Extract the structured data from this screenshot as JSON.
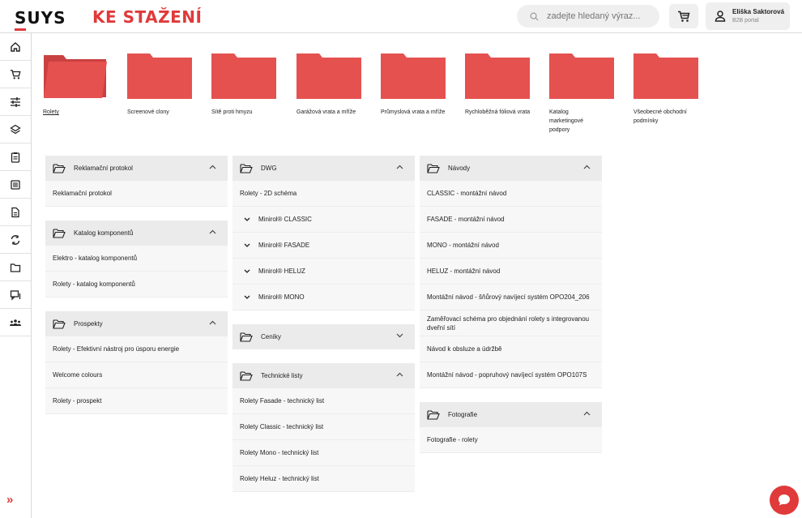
{
  "header": {
    "logo": "SUYS",
    "title": "KE STAŽENÍ",
    "search_placeholder": "zadejte hledaný výraz...",
    "user_name": "Eliška Saktorová",
    "user_role": "B2B portal"
  },
  "colors": {
    "accent": "#e03a3a",
    "folder": "#e5514f"
  },
  "sidebar": {
    "icons": [
      "home-icon",
      "cart-icon",
      "sliders-icon",
      "layers-icon",
      "clipboard-icon",
      "list-icon",
      "document-icon",
      "sync-icon",
      "folder-icon",
      "chat-icon",
      "users-icon"
    ],
    "expand": "»"
  },
  "folders": [
    {
      "label": "Rolety",
      "active": true
    },
    {
      "label": "Screenové clony"
    },
    {
      "label": "Sítě proti hmyzu"
    },
    {
      "label": "Garážová vrata a mříže"
    },
    {
      "label": "Průmyslová vrata a mříže"
    },
    {
      "label": "Rychloběžná fóliová vrata"
    },
    {
      "label": "Katalog marketingové podpory"
    },
    {
      "label": "Všeobecné obchodní podmínky"
    }
  ],
  "col1": {
    "reklamacni": {
      "title": "Reklamační protokol",
      "items": [
        "Reklamační protokol"
      ]
    },
    "katalog": {
      "title": "Katalog komponentů",
      "items": [
        "Elektro - katalog komponentů",
        "Rolety - katalog komponentů"
      ]
    },
    "prospekty": {
      "title": "Prospekty",
      "items": [
        "Rolety - Efektivní nástroj pro úsporu energie",
        "Welcome colours",
        "Rolety - prospekt"
      ]
    }
  },
  "col2": {
    "dwg": {
      "title": "DWG",
      "items": [
        "Rolety - 2D schéma"
      ],
      "subgroups": [
        "Minirol® CLASSIC",
        "Minirol® FASADE",
        "Minirol® HELUZ",
        "Minirol® MONO"
      ]
    },
    "ceniky": {
      "title": "Ceníky"
    },
    "technicke": {
      "title": "Technické listy",
      "items": [
        "Rolety Fasade - technický list",
        "Rolety Classic - technický list",
        "Rolety Mono - technický list",
        "Rolety Heluz - technický list"
      ]
    }
  },
  "col3": {
    "navody": {
      "title": "Návody",
      "items": [
        "CLASSIC - montážní návod",
        "FASADE - montážní návod",
        "MONO - montážní návod",
        "HELUZ - montážní návod",
        "Montážní návod - šňůrový navíjecí systém OPO204_206",
        "Zaměřovací schéma pro objednání rolety s integrovanou dveřní sítí",
        "Návod k obsluze a údržbě",
        "Montážní návod - popruhový navíjecí systém OPO107S"
      ]
    },
    "fotografie": {
      "title": "Fotografie",
      "items": [
        "Fotografie - rolety"
      ]
    }
  }
}
